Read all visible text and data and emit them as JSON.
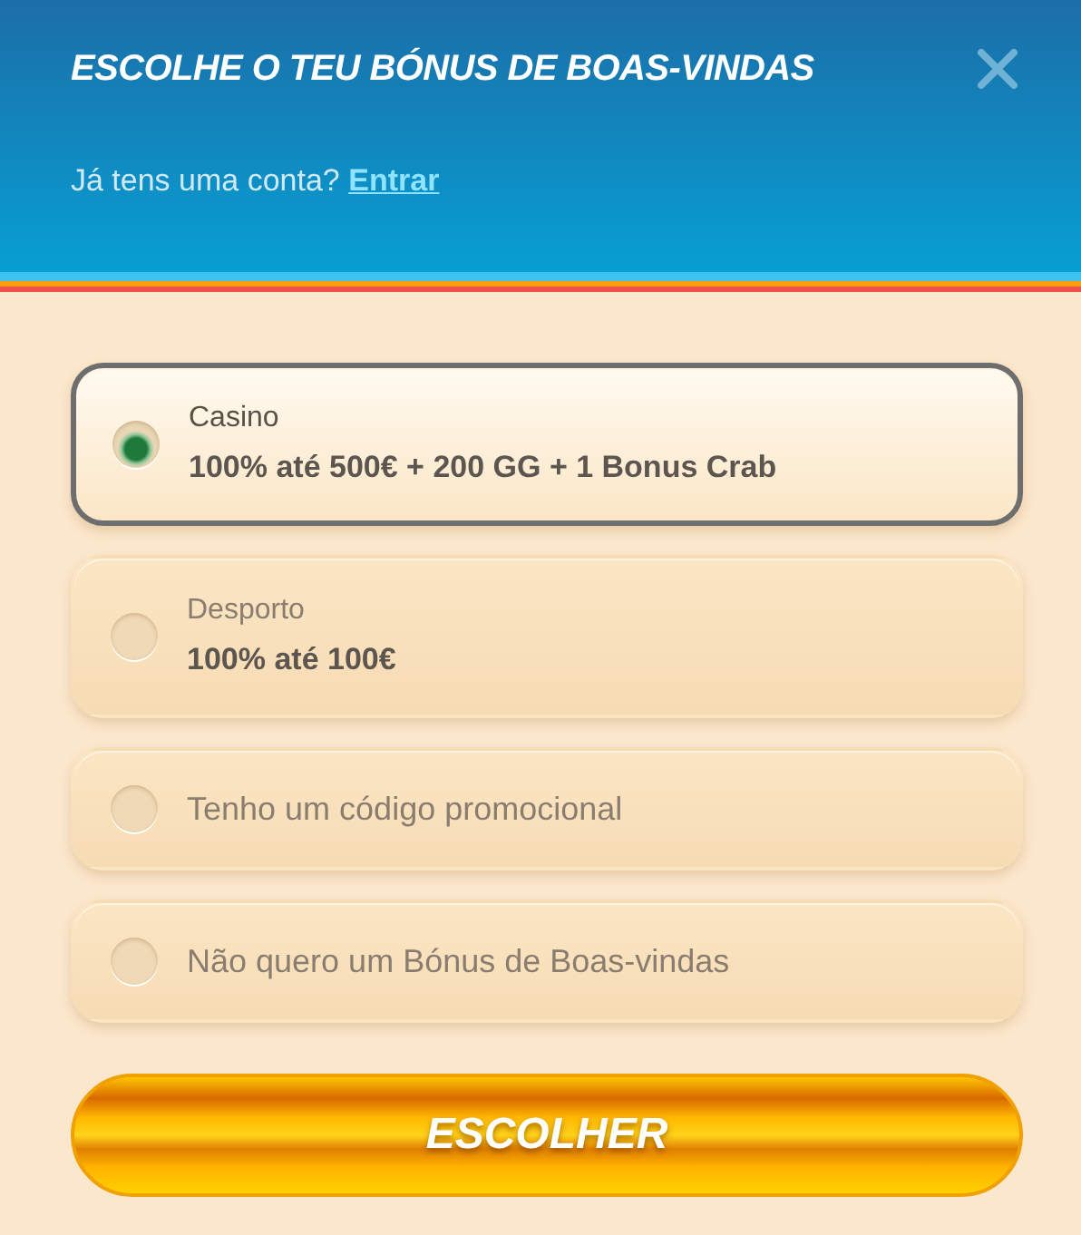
{
  "header": {
    "title": "ESCOLHE O TEU BÓNUS DE BOAS-VINDAS",
    "prompt": "Já tens uma conta?",
    "link": "Entrar"
  },
  "options": [
    {
      "title": "Casino",
      "detail": "100% até 500€ + 200 GG + 1 Bonus Crab",
      "selected": true
    },
    {
      "title": "Desporto",
      "detail": "100% até 100€",
      "selected": false
    },
    {
      "title": "Tenho um código promocional",
      "selected": false
    },
    {
      "title": "Não quero um Bónus de Boas-vindas",
      "selected": false
    }
  ],
  "button": "ESCOLHER"
}
